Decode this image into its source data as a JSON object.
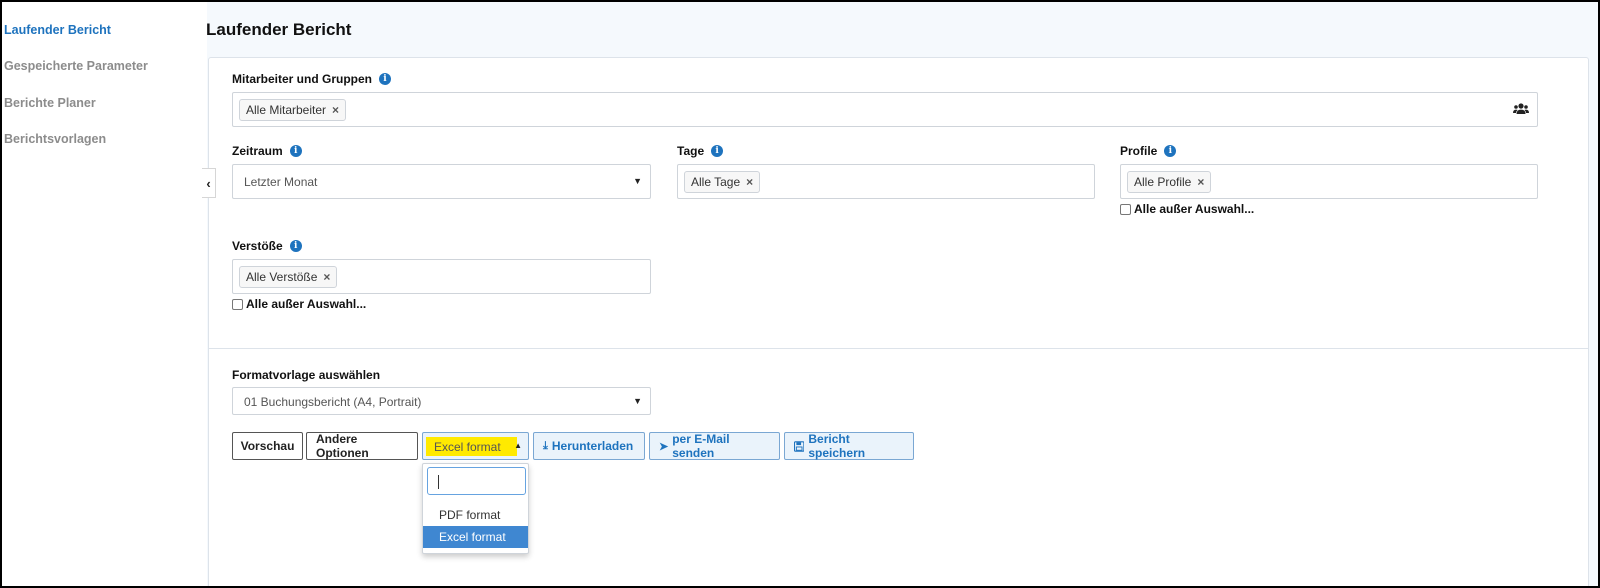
{
  "sidebar": {
    "items": [
      {
        "label": "Laufender Bericht",
        "active": true
      },
      {
        "label": "Gespeicherte Parameter",
        "active": false
      },
      {
        "label": "Berichte Planer",
        "active": false
      },
      {
        "label": "Berichtsvorlagen",
        "active": false
      }
    ]
  },
  "page": {
    "title": "Laufender Bericht"
  },
  "form": {
    "employees": {
      "label": "Mitarbeiter und Gruppen",
      "tag": "Alle Mitarbeiter"
    },
    "period": {
      "label": "Zeitraum",
      "value": "Letzter Monat"
    },
    "days": {
      "label": "Tage",
      "tag": "Alle Tage"
    },
    "profiles": {
      "label": "Profile",
      "tag": "Alle Profile",
      "except_label": "Alle außer Auswahl..."
    },
    "violations": {
      "label": "Verstöße",
      "tag": "Alle Verstöße",
      "except_label": "Alle außer Auswahl..."
    },
    "template": {
      "label": "Formatvorlage auswählen",
      "value": "01 Buchungsbericht (A4, Portrait)"
    }
  },
  "actions": {
    "preview": "Vorschau",
    "other_options": "Andere Optionen",
    "format_selected": "Excel format",
    "download": "Herunterladen",
    "email": "per E-Mail senden",
    "save": "Bericht speichern"
  },
  "format_dropdown": {
    "search_value": "",
    "options": [
      {
        "label": "PDF format",
        "selected": false
      },
      {
        "label": "Excel format",
        "selected": true
      }
    ]
  },
  "icons": {
    "info": "info-circle-icon",
    "remove": "times-icon",
    "people": "users-icon",
    "download": "download-icon",
    "email": "paper-plane-icon",
    "save": "floppy-disk-icon"
  },
  "colors": {
    "accent": "#1e73be",
    "highlight": "#ffea00",
    "selected_option": "#3f87d1"
  }
}
